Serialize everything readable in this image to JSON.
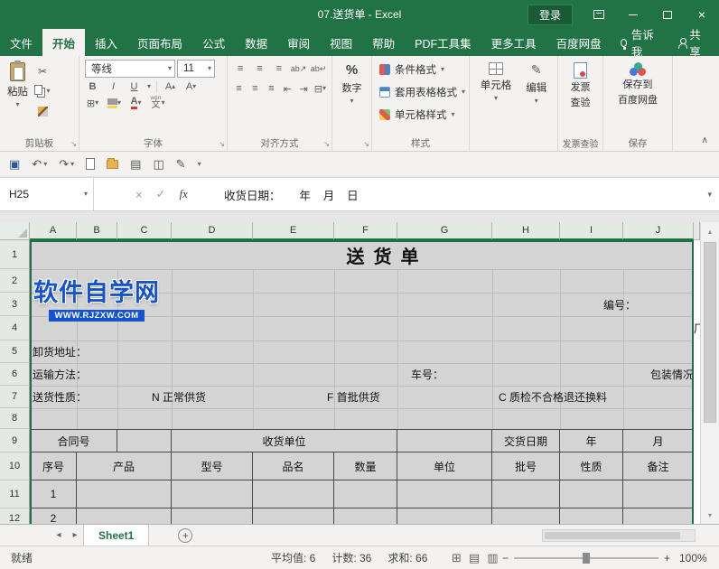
{
  "titlebar": {
    "title": "07.送货单 - Excel",
    "login": "登录"
  },
  "tabbar": {
    "file": "文件",
    "tabs": [
      "开始",
      "插入",
      "页面布局",
      "公式",
      "数据",
      "审阅",
      "视图",
      "帮助",
      "PDF工具集",
      "更多工具",
      "百度网盘"
    ],
    "tell_me": "告诉我",
    "share": "共享"
  },
  "ribbon": {
    "paste": "粘贴",
    "clipboard_group": "剪贴板",
    "font_name": "等线",
    "font_size": "11",
    "bold": "B",
    "italic": "I",
    "underline": "U",
    "grow": "A",
    "shrink": "A",
    "font_color_a": "A",
    "wen_top": "wén",
    "wen_char": "文",
    "font_group": "字体",
    "align_group": "对齐方式",
    "percent": "%",
    "number_group": "数字",
    "conditional": "条件格式",
    "format_table": "套用表格格式",
    "cell_styles": "单元格样式",
    "styles_group": "样式",
    "cells_btn": "单元格",
    "edit_btn": "编辑",
    "invoice_l1": "发票",
    "invoice_l2": "查验",
    "invoice_group": "发票查验",
    "baidu_l1": "保存到",
    "baidu_l2": "百度网盘",
    "baidu_group": "保存"
  },
  "formula_bar": {
    "name_box": "H25",
    "fx": "fx",
    "content": "收货日期：      年    月    日"
  },
  "grid": {
    "col_headers": [
      "A",
      "B",
      "C",
      "D",
      "E",
      "F",
      "G",
      "H",
      "I",
      "J"
    ],
    "row_headers": [
      "1",
      "2",
      "3",
      "4",
      "5",
      "6",
      "7",
      "8",
      "9",
      "10",
      "11",
      "12"
    ],
    "title": "送货单",
    "bianhao": "编号：",
    "chang": "厂",
    "xiehuo": "卸货地址：",
    "yunshu": "运输方法：",
    "chehao": "车号：",
    "baozhuang": "包装情况",
    "songhuo": "送货性质：",
    "opt_n": "N 正常供货",
    "opt_f": "F 首批供货",
    "opt_c": "C 质检不合格退还换料",
    "hetonghao": "合同号",
    "shouhuodanwei": "收货单位",
    "jiaohuoriqi": "交货日期",
    "nian": "年",
    "yue": "月",
    "th": [
      "序号",
      "产品",
      "型号",
      "品名",
      "数量",
      "单位",
      "批号",
      "性质",
      "备注"
    ],
    "r11": "1",
    "r12": "2"
  },
  "watermark": {
    "line1": "软件自学网",
    "line2": "WWW.RJZXW.COM"
  },
  "sheet_tabs": {
    "active": "Sheet1"
  },
  "status": {
    "ready": "就绪",
    "average": "平均值: 6",
    "count": "计数: 36",
    "sum": "求和: 66",
    "zoom": "100%"
  },
  "colors": {
    "accent": "#217346",
    "selection_fill": "#d4d4d4",
    "watermark_blue": "#1552d0"
  }
}
